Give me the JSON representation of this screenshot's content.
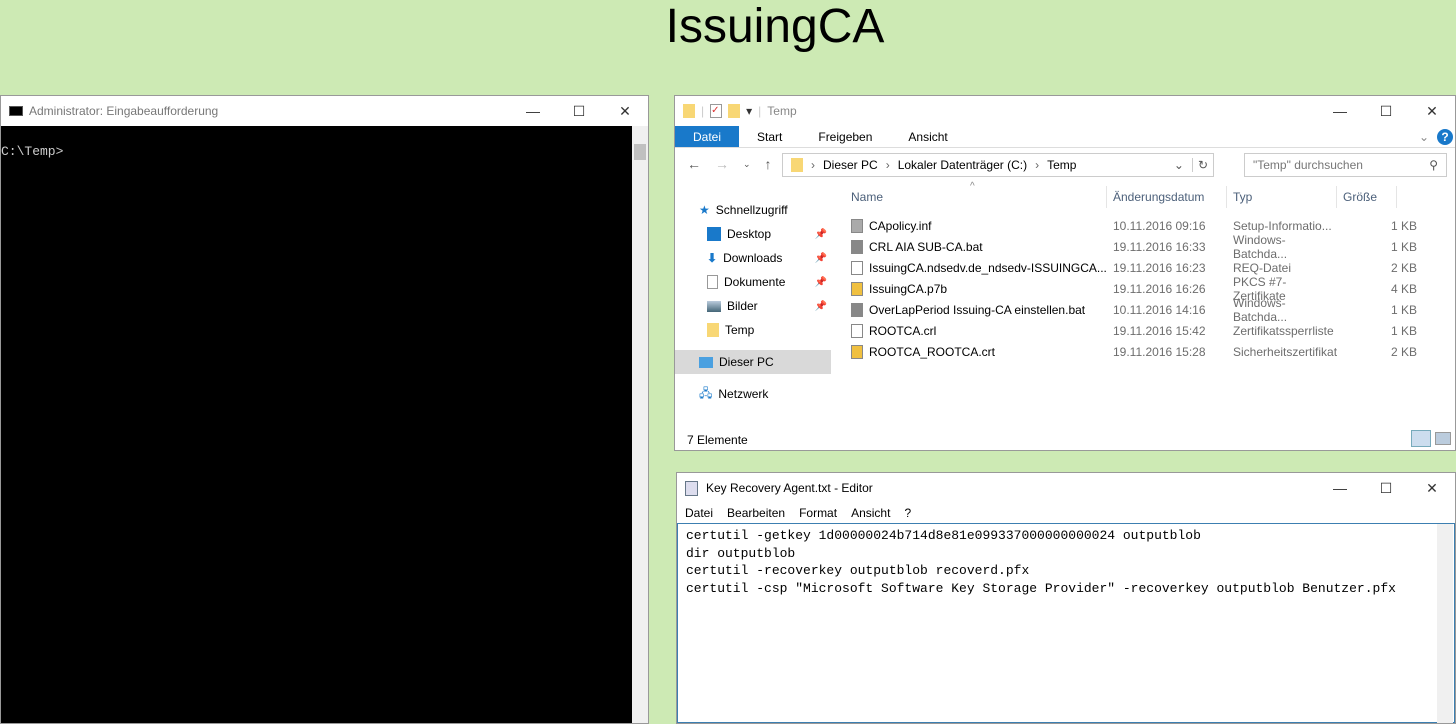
{
  "page_title": "IssuingCA",
  "cmd": {
    "title": "Administrator: Eingabeaufforderung",
    "prompt": "C:\\Temp>"
  },
  "explorer": {
    "title": "Temp",
    "tabs": [
      "Datei",
      "Start",
      "Freigeben",
      "Ansicht"
    ],
    "breadcrumb": [
      "Dieser PC",
      "Lokaler Datenträger (C:)",
      "Temp"
    ],
    "search_placeholder": "\"Temp\" durchsuchen",
    "nav": [
      {
        "label": "Schnellzugriff"
      },
      {
        "label": "Desktop"
      },
      {
        "label": "Downloads"
      },
      {
        "label": "Dokumente"
      },
      {
        "label": "Bilder"
      },
      {
        "label": "Temp"
      },
      {
        "label": "Dieser PC"
      },
      {
        "label": "Netzwerk"
      }
    ],
    "columns": [
      "Name",
      "Änderungsdatum",
      "Typ",
      "Größe"
    ],
    "files": [
      {
        "name": "CApolicy.inf",
        "date": "10.11.2016 09:16",
        "type": "Setup-Informatio...",
        "size": "1 KB"
      },
      {
        "name": "CRL AIA SUB-CA.bat",
        "date": "19.11.2016 16:33",
        "type": "Windows-Batchda...",
        "size": "1 KB"
      },
      {
        "name": "IssuingCA.ndsedv.de_ndsedv-ISSUINGCA...",
        "date": "19.11.2016 16:23",
        "type": "REQ-Datei",
        "size": "2 KB"
      },
      {
        "name": "IssuingCA.p7b",
        "date": "19.11.2016 16:26",
        "type": "PKCS #7-Zertifikate",
        "size": "4 KB"
      },
      {
        "name": "OverLapPeriod Issuing-CA einstellen.bat",
        "date": "10.11.2016 14:16",
        "type": "Windows-Batchda...",
        "size": "1 KB"
      },
      {
        "name": "ROOTCA.crl",
        "date": "19.11.2016 15:42",
        "type": "Zertifikatssperrliste",
        "size": "1 KB"
      },
      {
        "name": "ROOTCA_ROOTCA.crt",
        "date": "19.11.2016 15:28",
        "type": "Sicherheitszertifikat",
        "size": "2 KB"
      }
    ],
    "status": "7 Elemente"
  },
  "notepad": {
    "title": "Key Recovery Agent.txt - Editor",
    "menu": [
      "Datei",
      "Bearbeiten",
      "Format",
      "Ansicht",
      "?"
    ],
    "lines": [
      "certutil -getkey 1d00000024b714d8e81e099337000000000024 outputblob",
      "dir outputblob",
      "certutil -recoverkey outputblob recoverd.pfx",
      "certutil -csp \"Microsoft Software Key Storage Provider\" -recoverkey outputblob Benutzer.pfx"
    ]
  }
}
